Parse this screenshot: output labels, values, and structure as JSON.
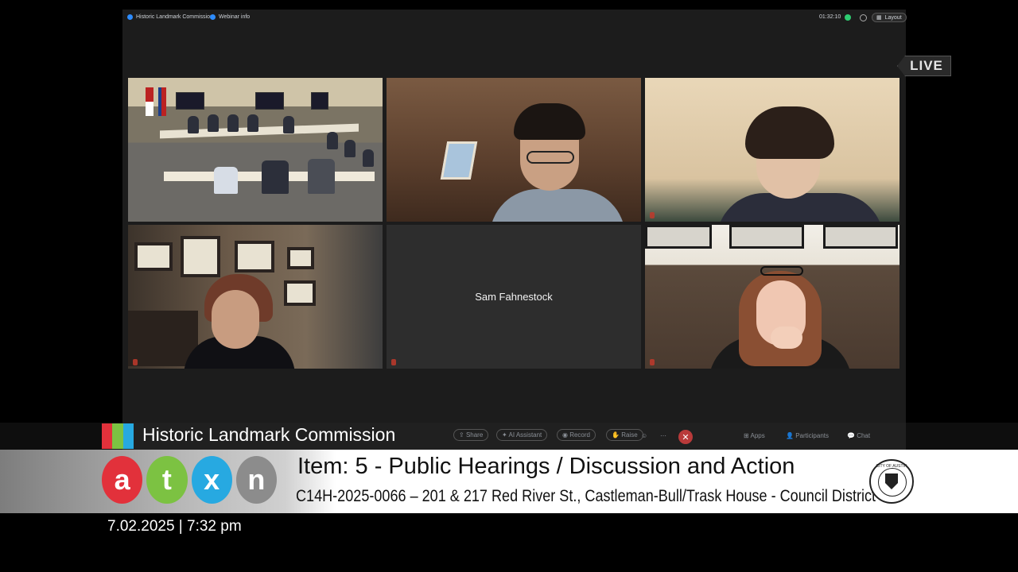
{
  "zoom": {
    "top_left_title": "Historic Landmark Commission",
    "webinar_info": "Webinar info",
    "timer": "01:32:10",
    "layout_label": "Layout"
  },
  "tiles": {
    "name_tile_label": "Sam Fahnestock"
  },
  "live_badge": "LIVE",
  "toolbar": {
    "share": "Share",
    "ai_assistant": "AI Assistant",
    "record": "Record",
    "raise": "Raise",
    "end_icon": "close-icon",
    "apps": "Apps",
    "participants": "Participants",
    "chat": "Chat"
  },
  "lower_third": {
    "show_title": "Historic Landmark Commission",
    "logo_letters": [
      "a",
      "t",
      "x",
      "n"
    ],
    "logo_colors": [
      "#e2313b",
      "#7cc242",
      "#27a9e1",
      "#8c8c8c"
    ],
    "title_bar_colors": [
      "#e2313b",
      "#7cc242",
      "#27a9e1"
    ],
    "item_title": "Item: 5 - Public Hearings / Discussion and Action",
    "item_subtitle": "C14H-2025-0066 – 201 & 217 Red River St., Castleman-Bull/Trask House - Council District 9",
    "seal_text": "CITY OF AUSTIN",
    "datetime": "7.02.2025 | 7:32 pm"
  }
}
